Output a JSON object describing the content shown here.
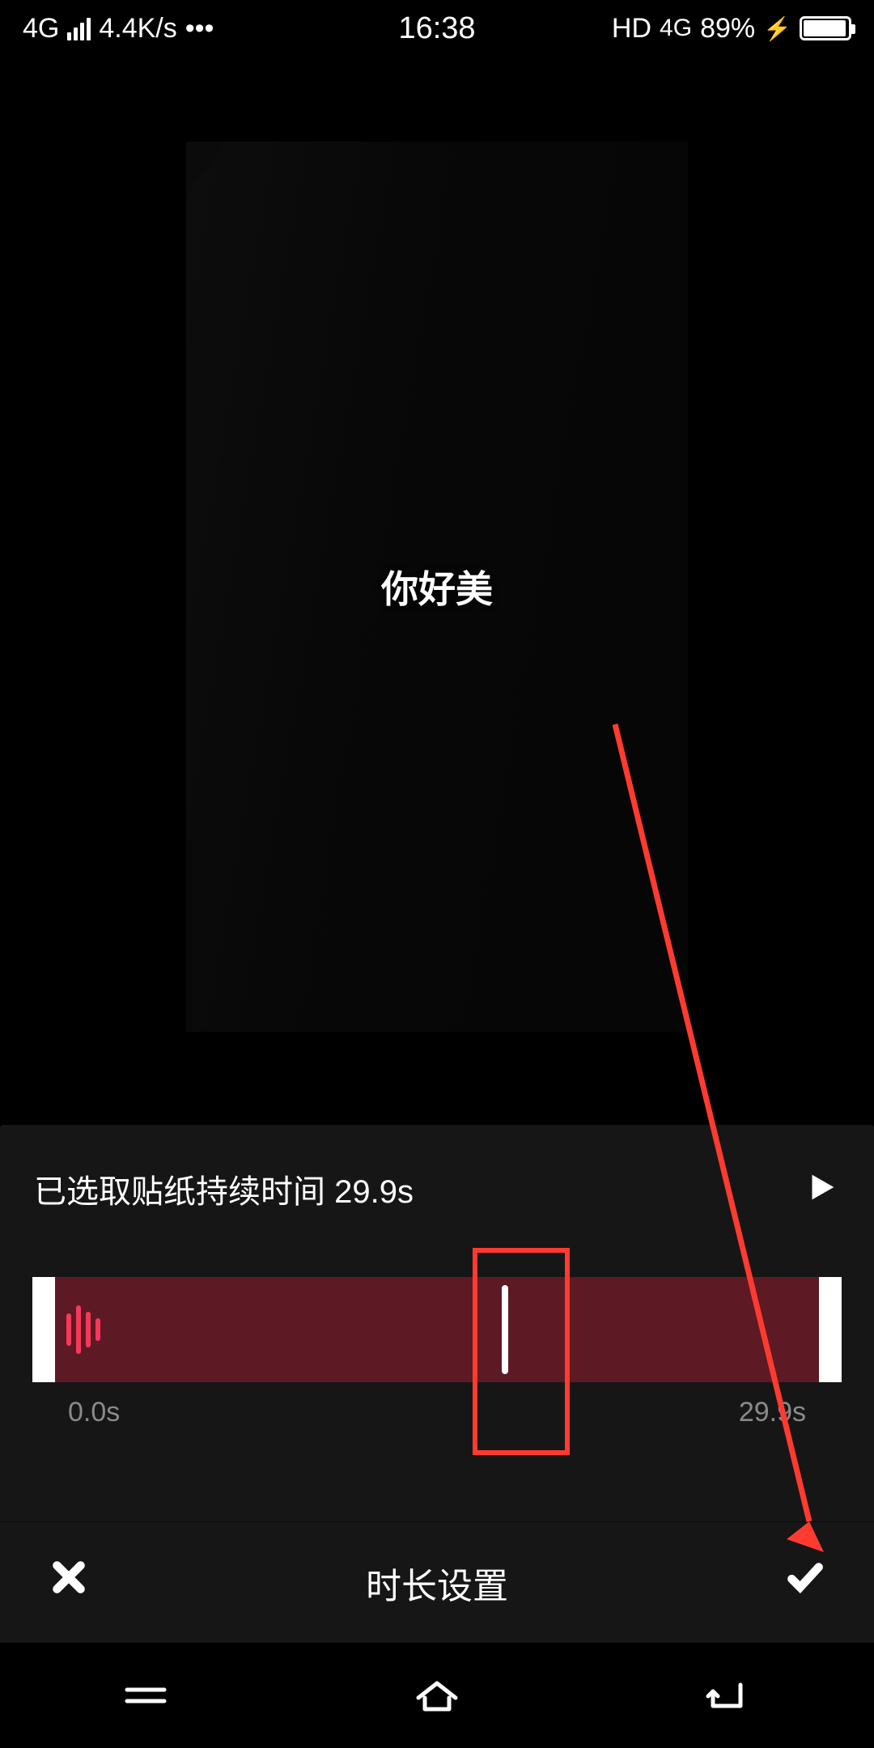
{
  "status": {
    "network_type": "4G",
    "data_rate": "4.4K/s",
    "time": "16:38",
    "hd_label": "HD",
    "net_gen": "4G",
    "battery_pct": "89%",
    "charging_glyph": "⚡"
  },
  "preview": {
    "sticker_text": "你好美"
  },
  "sheet": {
    "selected_label": "已选取贴纸持续时间 29.9s",
    "time_start": "0.0s",
    "time_end": "29.9s"
  },
  "footer": {
    "title": "时长设置"
  },
  "annotation": {
    "arrow_color": "#ff3b30"
  }
}
